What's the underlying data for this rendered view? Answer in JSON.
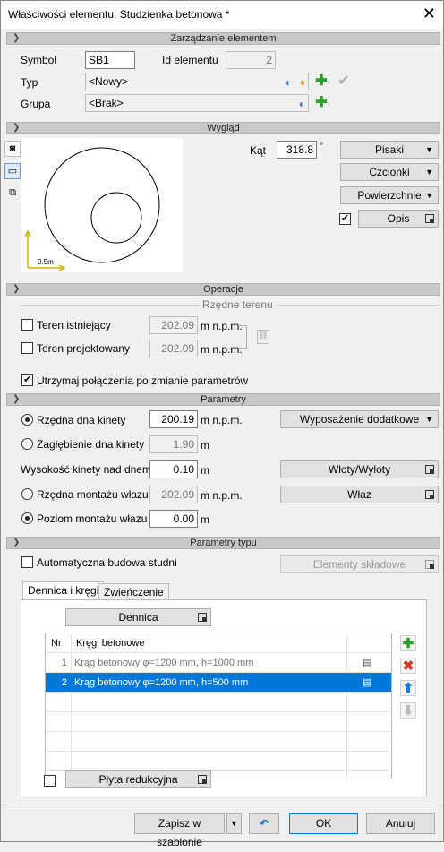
{
  "window": {
    "title": "Właściwości elementu: Studzienka betonowa *"
  },
  "sections": {
    "management": "Zarządzanie elementem",
    "appearance": "Wygląd",
    "operations": "Operacje",
    "parameters": "Parametry",
    "type_parameters": "Parametry typu"
  },
  "management": {
    "symbol_label": "Symbol",
    "symbol_value": "SB1",
    "id_label": "Id elementu",
    "id_value": "2",
    "type_label": "Typ",
    "type_value": "<Nowy>",
    "group_label": "Grupa",
    "group_value": "<Brak>"
  },
  "appearance": {
    "angle_label": "Kąt",
    "angle_value": "318.8",
    "angle_unit": "°",
    "scale_label": "0.5m",
    "pens_button": "Pisaki",
    "fonts_button": "Czcionki",
    "surfaces_button": "Powierzchnie",
    "description_button": "Opis",
    "description_checked": true
  },
  "operations": {
    "terrain_group": "Rzędne terenu",
    "existing_label": "Teren istniejący",
    "existing_value": "202.09",
    "existing_unit": "m n.p.m.",
    "designed_label": "Teren projektowany",
    "designed_value": "202.09",
    "designed_unit": "m n.p.m.",
    "keep_connections_label": "Utrzymaj połączenia po zmianie parametrów",
    "keep_connections_checked": true
  },
  "parameters": {
    "bottom_ordinate_label": "Rzędna dna kinety",
    "bottom_ordinate_value": "200.19",
    "bottom_ordinate_unit": "m n.p.m.",
    "depth_label": "Zagłębienie dna kinety",
    "depth_value": "1.90",
    "depth_unit": "m",
    "kinet_height_label": "Wysokość kinety nad dnem",
    "kinet_height_value": "0.10",
    "kinet_height_unit": "m",
    "hatch_ordinate_label": "Rzędna montażu włazu",
    "hatch_ordinate_value": "202.09",
    "hatch_ordinate_unit": "m n.p.m.",
    "hatch_level_label": "Poziom montażu włazu",
    "hatch_level_value": "0.00",
    "hatch_level_unit": "m",
    "equipment_button": "Wyposażenie dodatkowe",
    "inlets_button": "Wloty/Wyloty",
    "hatch_button": "Właz",
    "selected_radio": "bottom_ordinate_and_hatch_level"
  },
  "type_params": {
    "auto_build_label": "Automatyczna budowa studni",
    "components_button": "Elementy składowe",
    "tabs": [
      "Dennica i kręgi",
      "Zwieńczenie"
    ],
    "bottom_button": "Dennica",
    "grid_headers": [
      "Nr",
      "Kręgi betonowe"
    ],
    "rows": [
      {
        "nr": "1",
        "name": "Krąg betonowy φ=1200 mm, h=1000 mm"
      },
      {
        "nr": "2",
        "name": "Krąg betonowy φ=1200 mm, h=500 mm"
      }
    ],
    "selected_row": 2,
    "reduction_plate_button": "Płyta redukcyjna"
  },
  "footer": {
    "save_template": "Zapisz w szablonie",
    "ok": "OK",
    "cancel": "Anuluj"
  },
  "colors": {
    "selection": "#0078d7",
    "add_green": "#2e9e2e",
    "delete_red": "#d9342b",
    "up_blue": "#1e78d6"
  }
}
